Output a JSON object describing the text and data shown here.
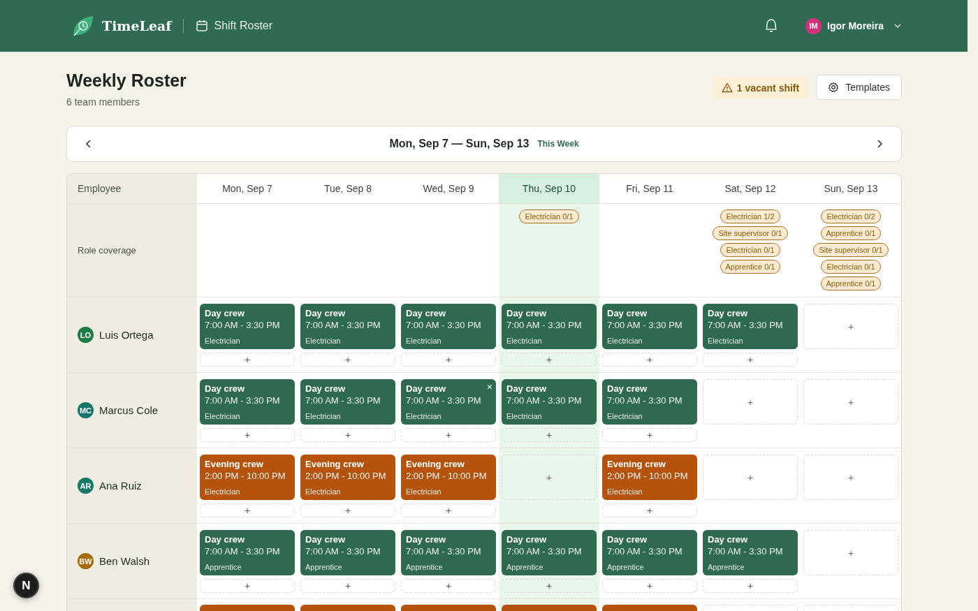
{
  "header": {
    "brand": "TimeLeaf",
    "section": "Shift Roster",
    "user": {
      "initials": "IM",
      "name": "Igor Moreira",
      "color": "#d42f7c"
    }
  },
  "page": {
    "title": "Weekly Roster",
    "subtitle": "6 team members",
    "vacancy": "1 vacant shift",
    "templates_button": "Templates"
  },
  "week": {
    "range": "Mon, Sep 7 — Sun, Sep 13",
    "tag": "This Week"
  },
  "roster": {
    "employee_heading": "Employee",
    "coverage_label": "Role coverage",
    "days": [
      {
        "label": "Mon, Sep 7",
        "today": false
      },
      {
        "label": "Tue, Sep 8",
        "today": false
      },
      {
        "label": "Wed, Sep 9",
        "today": false
      },
      {
        "label": "Thu, Sep 10",
        "today": true,
        "coverage": [
          "Electrician 0/1"
        ]
      },
      {
        "label": "Fri, Sep 11",
        "today": false
      },
      {
        "label": "Sat, Sep 12",
        "today": false,
        "coverage": [
          "Electrician 1/2",
          "Site supervisor 0/1",
          "Electrician 0/1",
          "Apprentice 0/1"
        ]
      },
      {
        "label": "Sun, Sep 13",
        "today": false,
        "coverage": [
          "Electrician 0/2",
          "Apprentice 0/1",
          "Site supervisor 0/1",
          "Electrician 0/1",
          "Apprentice 0/1"
        ]
      }
    ],
    "employees": [
      {
        "initials": "LO",
        "name": "Luis Ortega",
        "color": "#1e7d45",
        "cells": [
          {
            "kind": "day",
            "title": "Day crew",
            "time": "7:00 AM - 3:30 PM",
            "role": "Electrician",
            "add": "+"
          },
          {
            "kind": "day",
            "title": "Day crew",
            "time": "7:00 AM - 3:30 PM",
            "role": "Electrician",
            "add": "+"
          },
          {
            "kind": "day",
            "title": "Day crew",
            "time": "7:00 AM - 3:30 PM",
            "role": "Electrician",
            "add": "+"
          },
          {
            "kind": "day",
            "title": "Day crew",
            "time": "7:00 AM - 3:30 PM",
            "role": "Electrician",
            "add": "+"
          },
          {
            "kind": "day",
            "title": "Day crew",
            "time": "7:00 AM - 3:30 PM",
            "role": "Electrician",
            "add": "+"
          },
          {
            "kind": "day",
            "title": "Day crew",
            "time": "7:00 AM - 3:30 PM",
            "role": "Electrician",
            "add": "+"
          },
          {
            "kind": "empty",
            "add": "+"
          }
        ]
      },
      {
        "initials": "MC",
        "name": "Marcus Cole",
        "color": "#17756a",
        "cells": [
          {
            "kind": "day",
            "title": "Day crew",
            "time": "7:00 AM - 3:30 PM",
            "role": "Electrician",
            "add": "+"
          },
          {
            "kind": "day",
            "title": "Day crew",
            "time": "7:00 AM - 3:30 PM",
            "role": "Electrician",
            "add": "+"
          },
          {
            "kind": "day",
            "title": "Day crew",
            "time": "7:00 AM - 3:30 PM",
            "role": "Electrician",
            "add": "+",
            "remove": "×"
          },
          {
            "kind": "day",
            "title": "Day crew",
            "time": "7:00 AM - 3:30 PM",
            "role": "Electrician",
            "add": "+"
          },
          {
            "kind": "day",
            "title": "Day crew",
            "time": "7:00 AM - 3:30 PM",
            "role": "Electrician",
            "add": "+"
          },
          {
            "kind": "empty",
            "add": "+"
          },
          {
            "kind": "empty",
            "add": "+"
          }
        ]
      },
      {
        "initials": "AR",
        "name": "Ana Ruiz",
        "color": "#177a68",
        "cells": [
          {
            "kind": "evening",
            "title": "Evening crew",
            "time": "2:00 PM - 10:00 PM",
            "role": "Electrician",
            "add": "+"
          },
          {
            "kind": "evening",
            "title": "Evening crew",
            "time": "2:00 PM - 10:00 PM",
            "role": "Electrician",
            "add": "+"
          },
          {
            "kind": "evening",
            "title": "Evening crew",
            "time": "2:00 PM - 10:00 PM",
            "role": "Electrician",
            "add": "+"
          },
          {
            "kind": "empty",
            "add": "+"
          },
          {
            "kind": "evening",
            "title": "Evening crew",
            "time": "2:00 PM - 10:00 PM",
            "role": "Electrician",
            "add": "+"
          },
          {
            "kind": "empty",
            "add": "+"
          },
          {
            "kind": "empty",
            "add": "+"
          }
        ]
      },
      {
        "initials": "BW",
        "name": "Ben Walsh",
        "color": "#a66a0a",
        "cells": [
          {
            "kind": "day",
            "title": "Day crew",
            "time": "7:00 AM - 3:30 PM",
            "role": "Apprentice",
            "add": "+"
          },
          {
            "kind": "day",
            "title": "Day crew",
            "time": "7:00 AM - 3:30 PM",
            "role": "Apprentice",
            "add": "+"
          },
          {
            "kind": "day",
            "title": "Day crew",
            "time": "7:00 AM - 3:30 PM",
            "role": "Apprentice",
            "add": "+"
          },
          {
            "kind": "day",
            "title": "Day crew",
            "time": "7:00 AM - 3:30 PM",
            "role": "Apprentice",
            "add": "+"
          },
          {
            "kind": "day",
            "title": "Day crew",
            "time": "7:00 AM - 3:30 PM",
            "role": "Apprentice",
            "add": "+"
          },
          {
            "kind": "day",
            "title": "Day crew",
            "time": "7:00 AM - 3:30 PM",
            "role": "Apprentice",
            "add": "+"
          },
          {
            "kind": "empty",
            "add": "+"
          }
        ]
      }
    ],
    "partial_row": [
      {
        "kind": "evening"
      },
      {
        "kind": "evening"
      },
      {
        "kind": "evening"
      },
      {
        "kind": "evening"
      },
      {
        "kind": "evening"
      },
      {
        "kind": "empty"
      },
      {
        "kind": "empty"
      }
    ]
  },
  "dev_button": "N"
}
